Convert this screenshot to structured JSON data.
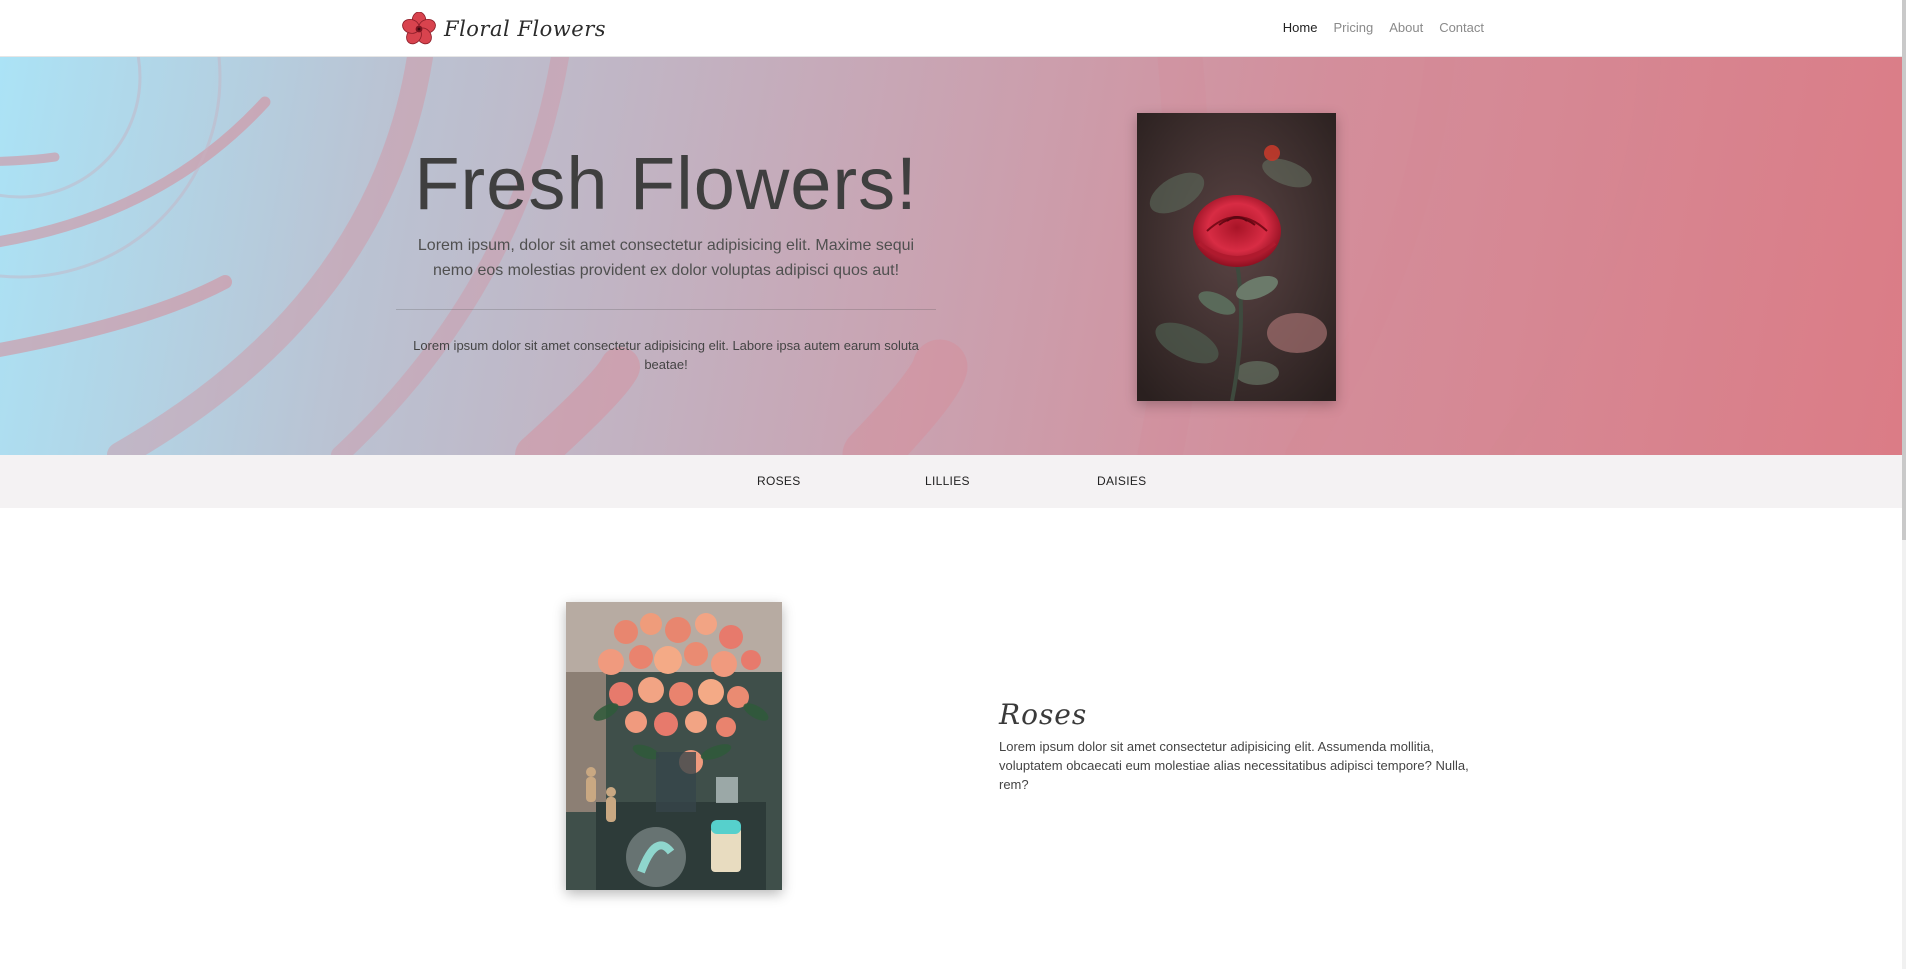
{
  "brand": {
    "name": "Floral Flowers",
    "logo_icon": "flower-logo-icon"
  },
  "nav": {
    "items": [
      {
        "label": "Home",
        "active": true
      },
      {
        "label": "Pricing",
        "active": false
      },
      {
        "label": "About",
        "active": false
      },
      {
        "label": "Contact",
        "active": false
      }
    ]
  },
  "hero": {
    "title": "Fresh Flowers!",
    "lead": "Lorem ipsum, dolor sit amet consectetur adipisicing elit. Maxime sequi nemo eos molestias provident ex dolor voluptas adipisci quos aut!",
    "small": "Lorem ipsum dolor sit amet consectetur adipisicing elit. Labore ipsa autem earum soluta beatae!",
    "image": "red-rose-photo"
  },
  "categories": {
    "tabs": [
      {
        "label": "ROSES"
      },
      {
        "label": "LILLIES"
      },
      {
        "label": "DAISIES"
      }
    ]
  },
  "feature": {
    "title": "Roses",
    "body": "Lorem ipsum dolor sit amet consectetur adipisicing elit. Assumenda mollitia, voluptatem obcaecati eum molestiae alias necessitatibus adipisci tempore? Nulla, rem?",
    "image": "rose-bouquet-photo"
  },
  "colors": {
    "hero_gradient_start": "#abe3f6",
    "hero_gradient_end": "#db7c86",
    "category_bar": "#f4f2f3",
    "logo_petal": "#d8434e"
  }
}
